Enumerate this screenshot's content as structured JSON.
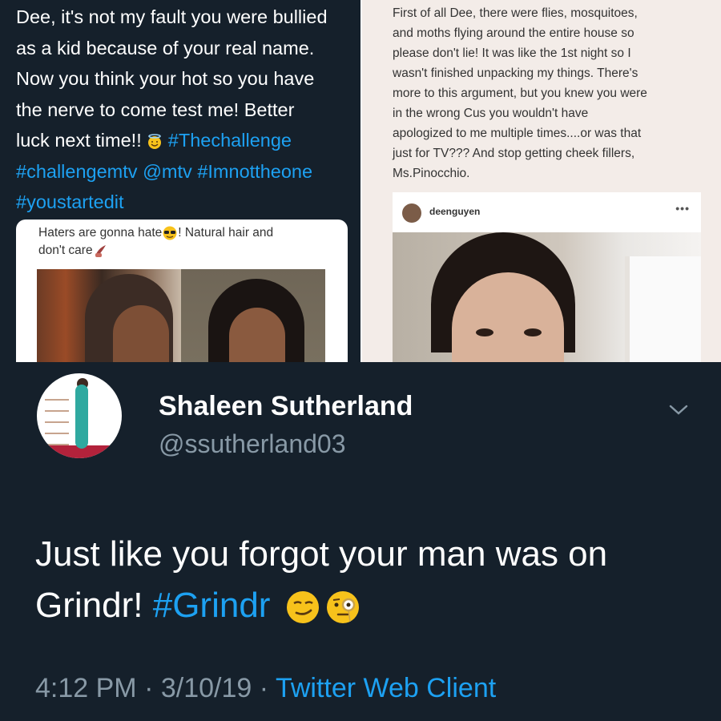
{
  "top_left": {
    "lines": [
      "Dee, it's not my fault you were bullied",
      "as a kid because of your real name.",
      "Now you think your hot so you have",
      "the nerve to come test me! Better"
    ],
    "last_line_text": "luck next time!!",
    "hashtags": {
      "thechallenge": "#Thechallenge",
      "challengemtv": "#challengemtv",
      "mtv": "@mtv",
      "imnottheone": "#Imnottheone",
      "youstartedit": "#youstartedit"
    },
    "quote": {
      "line1_a": "Haters are gonna hate",
      "line1_b": "! Natural hair and",
      "line2": "don't care"
    }
  },
  "top_right": {
    "lines": [
      "First of all Dee, there were flies, mosquitoes,",
      "and moths flying around the entire house so",
      "please don't lie! It was like the 1st night so I",
      "wasn't finished unpacking my things. There's",
      "more to this argument, but you knew you were",
      "in the wrong Cus you wouldn't have",
      "apologized to me multiple times....or was that",
      "just for TV??? And stop getting cheek fillers,",
      "Ms.Pinocchio."
    ],
    "instagram_username": "deenguyen",
    "instagram_more": "•••"
  },
  "bottom": {
    "display_name": "Shaleen Sutherland",
    "handle": "@ssutherland03",
    "tweet_line1": "Just like you forgot your man was on",
    "tweet_line2_a": "Grindr!",
    "tweet_hashtag": "#Grindr",
    "time": "4:12 PM",
    "date": "3/10/19",
    "separator": "·",
    "client": "Twitter Web Client"
  },
  "icons": [
    "innocent-halo-emoji-icon",
    "sunglasses-emoji-icon",
    "nail-polish-emoji-icon",
    "smirk-emoji-icon",
    "monocle-emoji-icon",
    "chevron-down-icon"
  ],
  "colors": {
    "background": "#15202b",
    "link": "#1da1f2",
    "secondary_text": "#8899a6"
  }
}
